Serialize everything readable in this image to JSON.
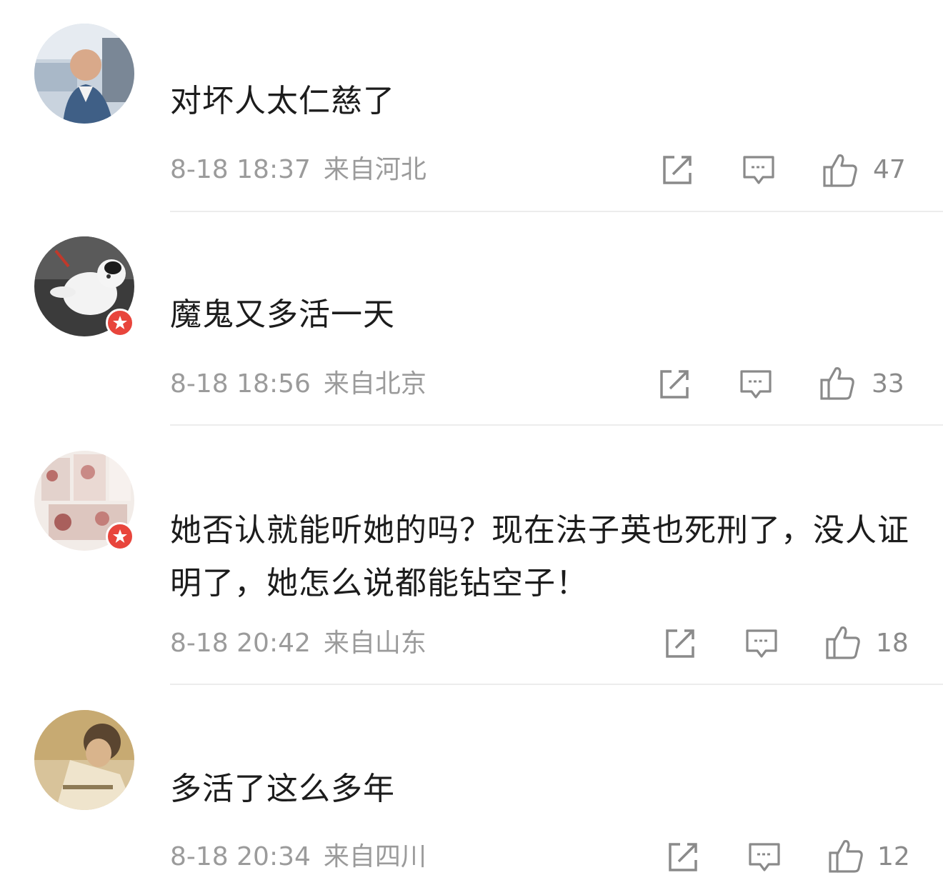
{
  "comments": [
    {
      "text": "对坏人太仁慈了",
      "date": "8-18 18:37",
      "location": "来自河北",
      "likes": "47",
      "verified": false
    },
    {
      "text": "魔鬼又多活一天",
      "date": "8-18 18:56",
      "location": "来自北京",
      "likes": "33",
      "verified": true
    },
    {
      "text": "她否认就能听她的吗？现在法子英也死刑了，没人证明了，她怎么说都能钻空子！",
      "date": "8-18 20:42",
      "location": "来自山东",
      "likes": "18",
      "verified": true
    },
    {
      "text": "多活了这么多年",
      "date": "8-18 20:34",
      "location": "来自四川",
      "likes": "12",
      "verified": false
    }
  ],
  "icons": {
    "share": "share-icon",
    "reply": "comment-icon",
    "like": "thumbs-up-icon",
    "verified": "verified-star-badge-icon"
  },
  "colors": {
    "text": "#1c1c1c",
    "meta": "#9b9b9b",
    "icon": "#8a8a8a",
    "badge": "#e8453c",
    "divider": "#ececec"
  }
}
